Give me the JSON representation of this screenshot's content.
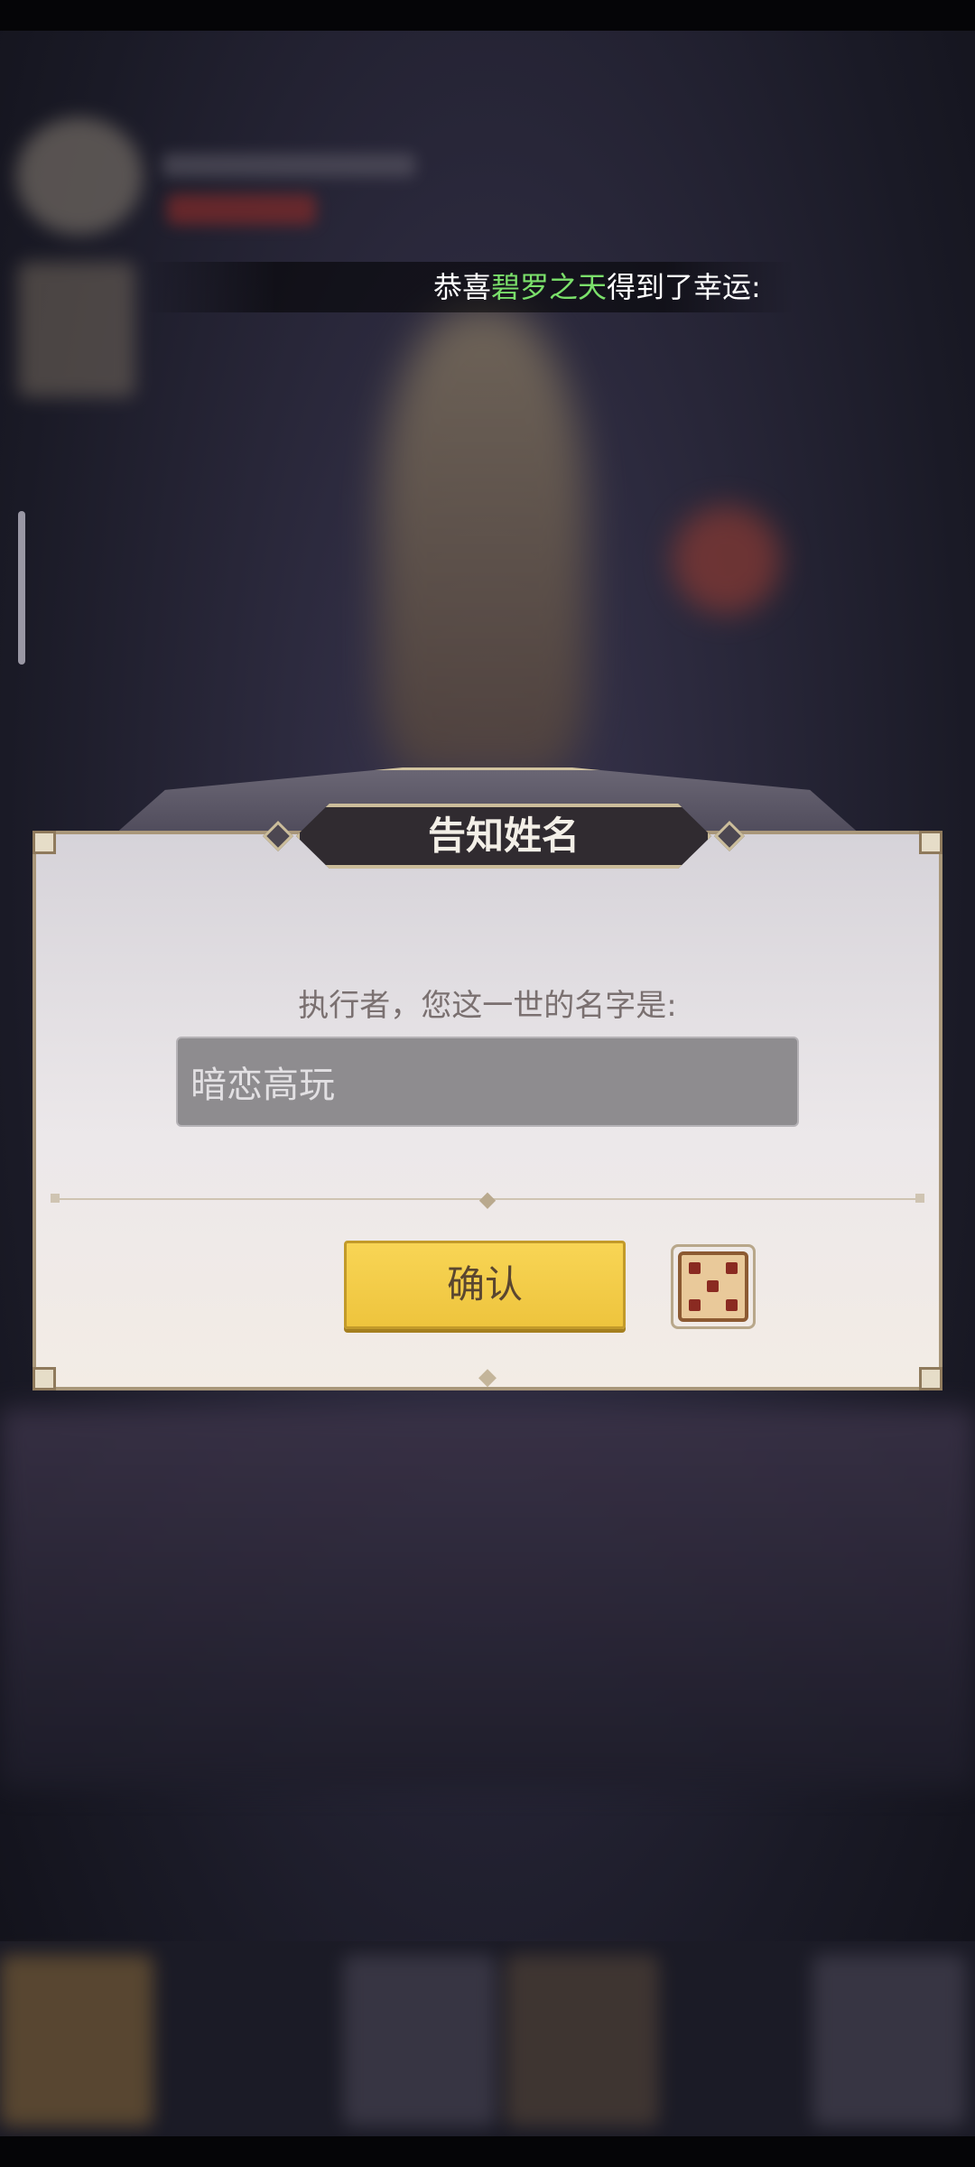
{
  "announcement": {
    "prefix": "恭喜",
    "player_name": "碧罗之天",
    "suffix": "得到了幸运:"
  },
  "dialog": {
    "title": "告知姓名",
    "prompt": "执行者，您这一世的名字是:",
    "name_value": "暗恋高玩",
    "confirm_label": "确认"
  },
  "icons": {
    "random_name": "dice-icon"
  },
  "colors": {
    "highlight_name": "#7be06b",
    "confirm_button": "#f5cf4b",
    "title_plate": "#302b30"
  }
}
